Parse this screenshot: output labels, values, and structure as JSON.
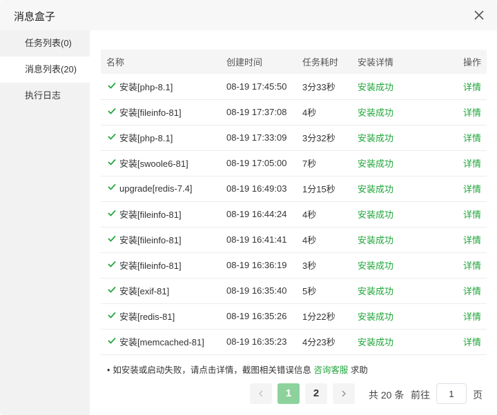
{
  "dialog": {
    "title": "消息盒子"
  },
  "sidebar": {
    "items": [
      {
        "label": "任务列表(0)"
      },
      {
        "label": "消息列表(20)"
      },
      {
        "label": "执行日志"
      }
    ]
  },
  "table": {
    "headers": {
      "name": "名称",
      "time": "创建时间",
      "duration": "任务耗时",
      "detail": "安装详情",
      "op": "操作"
    },
    "rows": [
      {
        "name": "安装[php-8.1]",
        "time": "08-19 17:45:50",
        "duration": "3分33秒",
        "status": "安装成功",
        "op": "详情"
      },
      {
        "name": "安装[fileinfo-81]",
        "time": "08-19 17:37:08",
        "duration": "4秒",
        "status": "安装成功",
        "op": "详情"
      },
      {
        "name": "安装[php-8.1]",
        "time": "08-19 17:33:09",
        "duration": "3分32秒",
        "status": "安装成功",
        "op": "详情"
      },
      {
        "name": "安装[swoole6-81]",
        "time": "08-19 17:05:00",
        "duration": "7秒",
        "status": "安装成功",
        "op": "详情"
      },
      {
        "name": "upgrade[redis-7.4]",
        "time": "08-19 16:49:03",
        "duration": "1分15秒",
        "status": "安装成功",
        "op": "详情"
      },
      {
        "name": "安装[fileinfo-81]",
        "time": "08-19 16:44:24",
        "duration": "4秒",
        "status": "安装成功",
        "op": "详情"
      },
      {
        "name": "安装[fileinfo-81]",
        "time": "08-19 16:41:41",
        "duration": "4秒",
        "status": "安装成功",
        "op": "详情"
      },
      {
        "name": "安装[fileinfo-81]",
        "time": "08-19 16:36:19",
        "duration": "3秒",
        "status": "安装成功",
        "op": "详情"
      },
      {
        "name": "安装[exif-81]",
        "time": "08-19 16:35:40",
        "duration": "5秒",
        "status": "安装成功",
        "op": "详情"
      },
      {
        "name": "安装[redis-81]",
        "time": "08-19 16:35:26",
        "duration": "1分22秒",
        "status": "安装成功",
        "op": "详情"
      },
      {
        "name": "安装[memcached-81]",
        "time": "08-19 16:35:23",
        "duration": "4分23秒",
        "status": "安装成功",
        "op": "详情"
      }
    ]
  },
  "note": {
    "bullet": "•",
    "text": "如安装或启动失败，请点击详情，截图相关错误信息",
    "link": "询客服",
    "link_prefix": "咨",
    "suffix": "求助"
  },
  "pagination": {
    "prev_icon": "chevron-left-icon",
    "next_icon": "chevron-right-icon",
    "pages": [
      "1",
      "2"
    ],
    "current": "1",
    "total": "共 20 条",
    "goto": "前往",
    "goto_value": "1",
    "unit": "页"
  },
  "colors": {
    "accent": "#20a53a",
    "active_page": "#8dd29d"
  }
}
